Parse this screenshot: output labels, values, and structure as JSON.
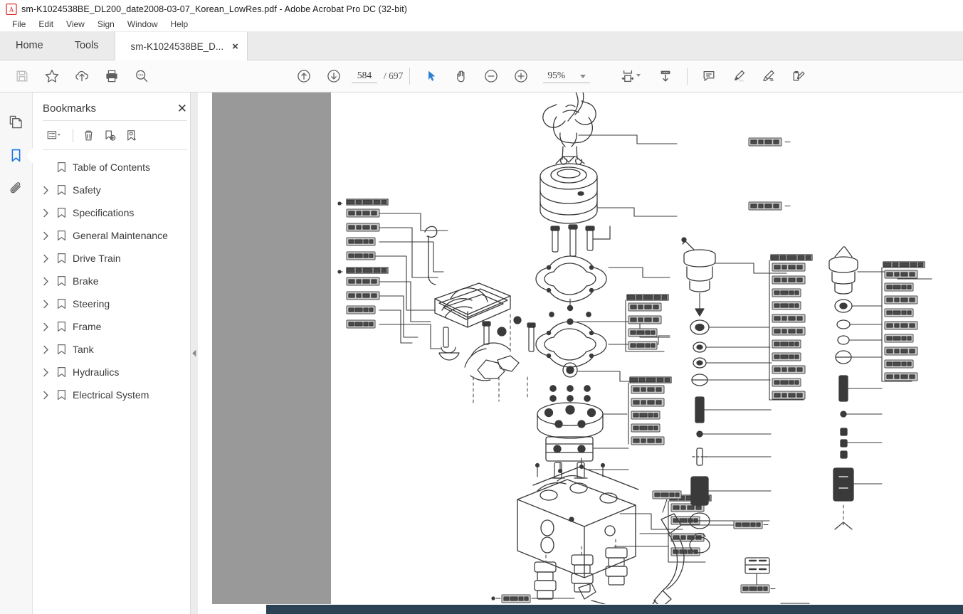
{
  "window": {
    "title": "sm-K1024538BE_DL200_date2008-03-07_Korean_LowRes.pdf - Adobe Acrobat Pro DC (32-bit)",
    "app_icon": "acrobat-icon"
  },
  "menubar": {
    "items": [
      {
        "label": "File"
      },
      {
        "label": "Edit"
      },
      {
        "label": "View"
      },
      {
        "label": "Sign"
      },
      {
        "label": "Window"
      },
      {
        "label": "Help"
      }
    ]
  },
  "tabs": {
    "home": "Home",
    "tools": "Tools",
    "document": "sm-K1024538BE_D...",
    "close_glyph": "×"
  },
  "toolbar": {
    "left": [
      {
        "name": "save-file-icon",
        "tooltip": "Save file"
      },
      {
        "name": "add-to-favorites-icon",
        "tooltip": "Add to favorites"
      },
      {
        "name": "upload-to-cloud-icon",
        "tooltip": "Upload to cloud"
      },
      {
        "name": "print-file-icon",
        "tooltip": "Print file"
      },
      {
        "name": "search-document-icon",
        "tooltip": "Find"
      }
    ],
    "center": [
      {
        "name": "previous-page-icon",
        "tooltip": "Previous page"
      },
      {
        "name": "next-page-icon",
        "tooltip": "Next page"
      },
      {
        "name": "select-tool-icon",
        "tooltip": "Select tool"
      },
      {
        "name": "hand-tool-icon",
        "tooltip": "Hand tool"
      },
      {
        "name": "zoom-out-icon",
        "tooltip": "Zoom out"
      },
      {
        "name": "zoom-in-icon",
        "tooltip": "Zoom in"
      }
    ],
    "right": [
      {
        "name": "fit-page-icon",
        "tooltip": "Fit page"
      },
      {
        "name": "scroll-mode-icon",
        "tooltip": "Scroll mode"
      },
      {
        "name": "add-comment-icon",
        "tooltip": "Add comment"
      },
      {
        "name": "highlight-text-icon",
        "tooltip": "Highlight text"
      },
      {
        "name": "draw-freehand-icon",
        "tooltip": "Draw freehand"
      },
      {
        "name": "fill-and-sign-icon",
        "tooltip": "Fill & Sign"
      }
    ],
    "page_current": "584",
    "page_total": "/ 697",
    "page_placeholder": "584",
    "zoom_level": "95%",
    "select_tool_color": "#2c7fd4"
  },
  "rail": {
    "items": [
      {
        "name": "page-thumbnails-icon",
        "label": "Page Thumbnails",
        "active": false
      },
      {
        "name": "bookmarks-icon",
        "label": "Bookmarks",
        "active": true
      },
      {
        "name": "attachments-icon",
        "label": "Attachments",
        "active": false
      }
    ],
    "active_color": "#1473e6"
  },
  "bookmarks_panel": {
    "title": "Bookmarks",
    "close_glyph": "✕",
    "tools": [
      {
        "name": "bookmark-options-icon",
        "tooltip": "Options"
      },
      {
        "name": "delete-bookmark-icon",
        "tooltip": "Delete bookmark"
      },
      {
        "name": "new-bookmark-icon",
        "tooltip": "New bookmark"
      },
      {
        "name": "find-bookmark-icon",
        "tooltip": "Highlight current bookmark"
      }
    ],
    "items": [
      {
        "label": "Table of Contents",
        "expandable": false
      },
      {
        "label": "Safety",
        "expandable": true
      },
      {
        "label": "Specifications",
        "expandable": true
      },
      {
        "label": "General Maintenance",
        "expandable": true
      },
      {
        "label": "Drive Train",
        "expandable": true
      },
      {
        "label": "Brake",
        "expandable": true
      },
      {
        "label": "Steering",
        "expandable": true
      },
      {
        "label": "Frame",
        "expandable": true
      },
      {
        "label": "Tank",
        "expandable": true
      },
      {
        "label": "Hydraulics",
        "expandable": true
      },
      {
        "label": "Electrical System",
        "expandable": true
      }
    ],
    "collapse_glyph": "◀"
  },
  "viewer": {
    "page_background": "#ffffff",
    "workspace_background": "#999999",
    "scrollbar_color": "#2b4254",
    "content_description": "Exploded parts diagram of a hydraulic pilot control valve assembly with leader lines to low-resolution callout label boxes"
  }
}
